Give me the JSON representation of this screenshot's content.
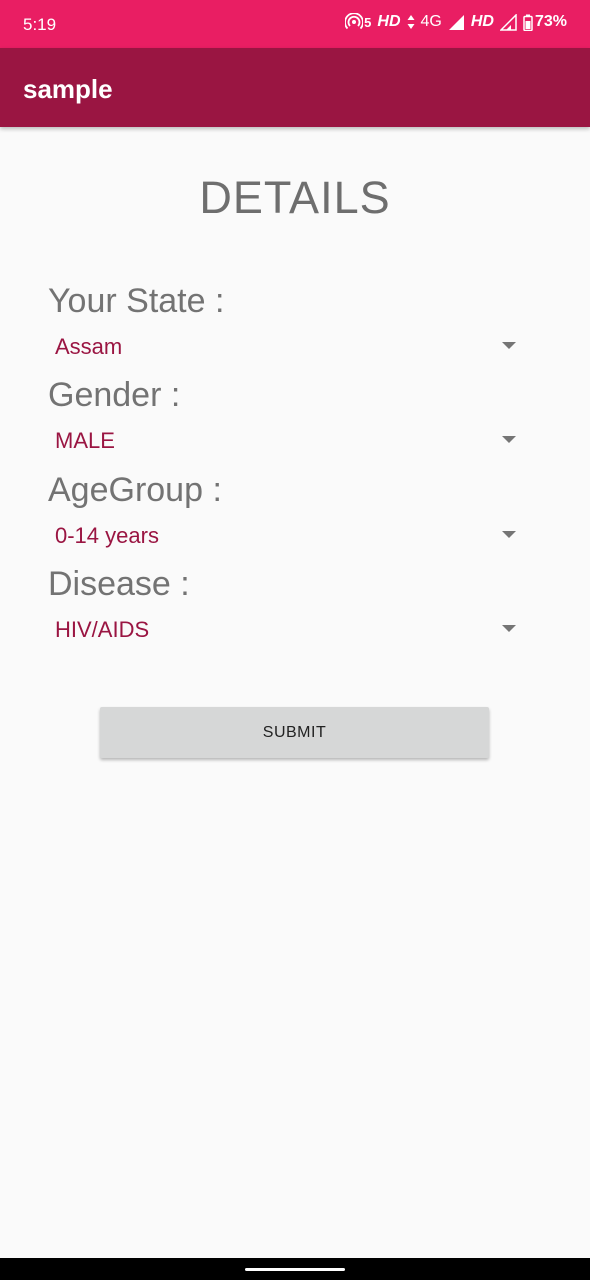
{
  "status_bar": {
    "time": "5:19",
    "hotspot_count": "5",
    "hd1": "HD",
    "network": "4G",
    "hd2": "HD",
    "battery": "73%"
  },
  "app_bar": {
    "title": "sample"
  },
  "form": {
    "heading": "DETAILS",
    "fields": [
      {
        "label": "Your State :",
        "value": "Assam"
      },
      {
        "label": "Gender :",
        "value": "MALE"
      },
      {
        "label": "AgeGroup :",
        "value": "0-14 years"
      },
      {
        "label": "Disease :",
        "value": "HIV/AIDS"
      }
    ],
    "submit_label": "SUBMIT"
  },
  "colors": {
    "status_bar": "#e91e63",
    "app_bar": "#9a1542",
    "spinner_text": "#9a1542",
    "background": "#fafafa"
  }
}
